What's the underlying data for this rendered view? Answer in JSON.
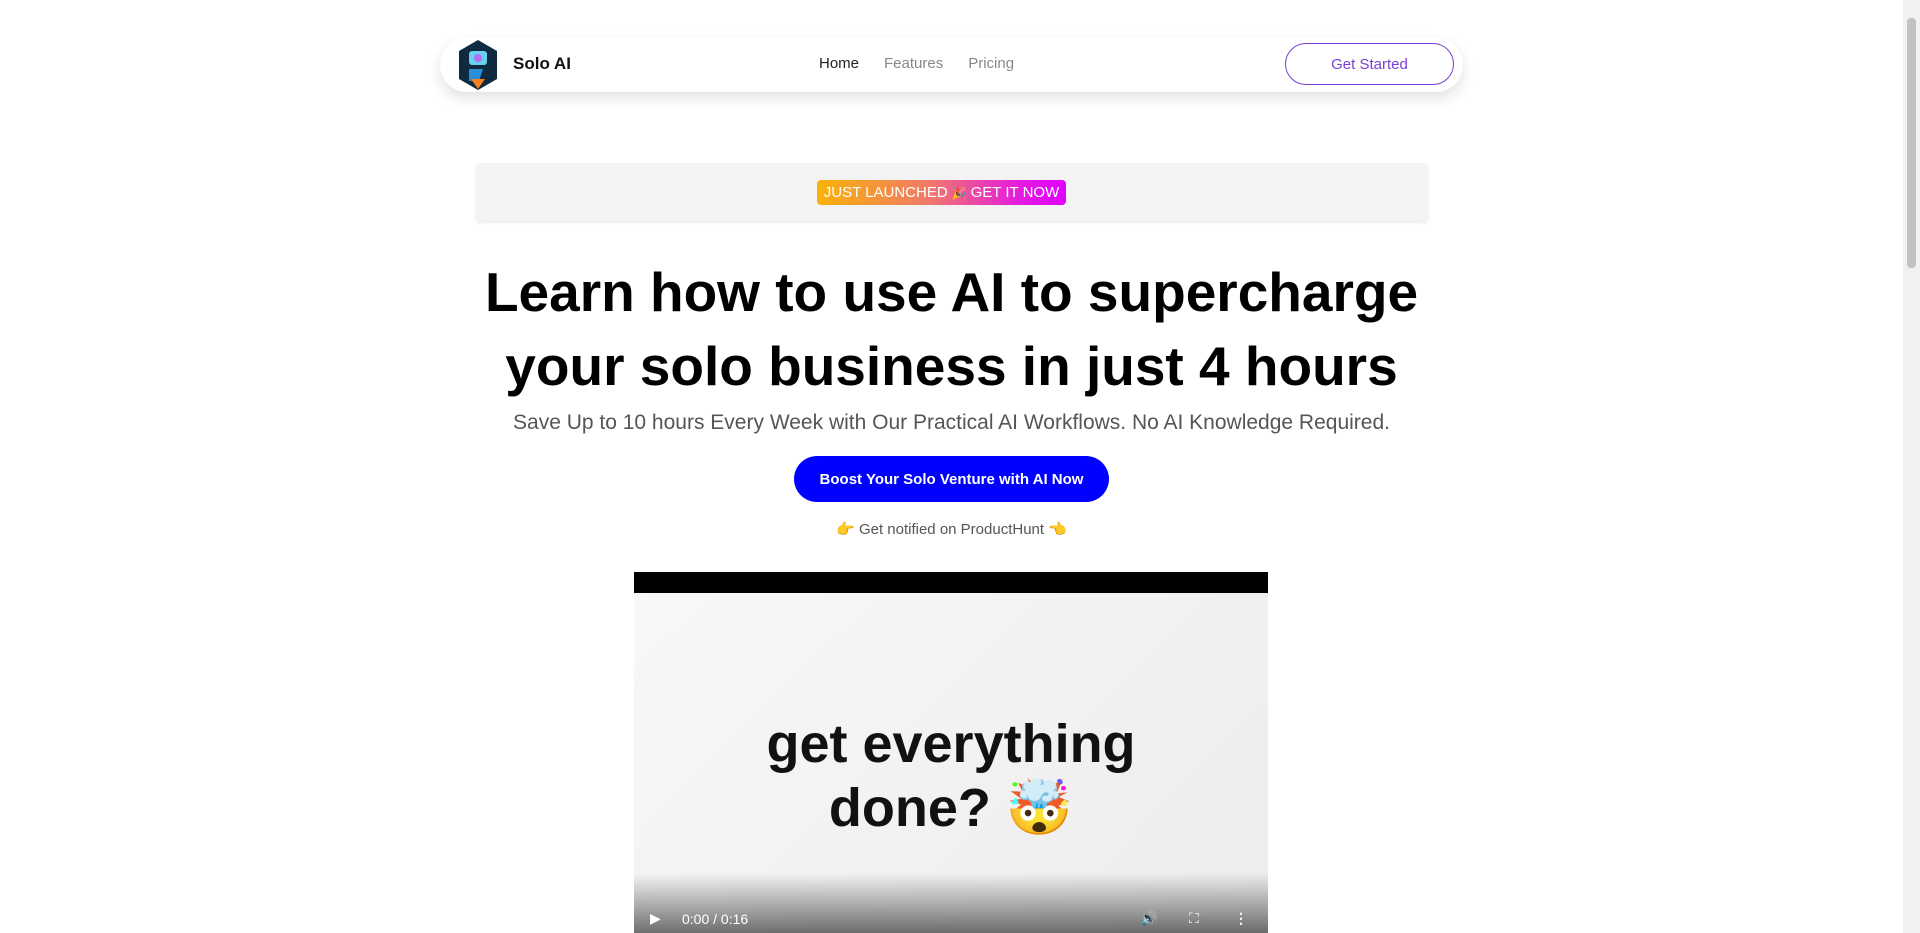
{
  "nav": {
    "brand": "Solo AI",
    "links": [
      "Home",
      "Features",
      "Pricing"
    ],
    "cta": "Get Started"
  },
  "banner": {
    "badge_left": "JUST LAUNCHED",
    "badge_icon": "🎉",
    "badge_right": "GET IT NOW"
  },
  "hero": {
    "title_line1": "Learn how to use AI to supercharge",
    "title_line2": "your solo business in just 4 hours",
    "subtitle": "Save Up to 10 hours Every Week with Our Practical AI Workflows. No AI Knowledge Required.",
    "cta": "Boost Your Solo Venture with AI Now",
    "notify_left": "👉",
    "notify": "Get notified on ProductHunt",
    "notify_right": "👈"
  },
  "video": {
    "caption_line1": "get everything",
    "caption_line2": "done? 🤯",
    "time": "0:00 / 0:16"
  },
  "colors": {
    "accent": "#0000ff",
    "purple": "#7b3fd6"
  }
}
